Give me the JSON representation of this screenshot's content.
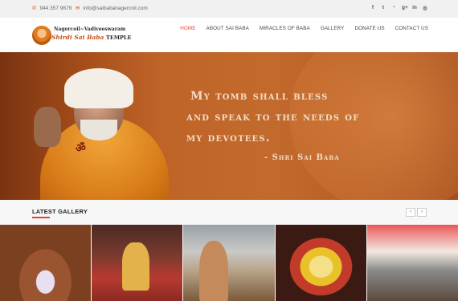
{
  "topbar": {
    "phone_icon": "phone-icon",
    "phone": "944 357 9679",
    "email_icon": "envelope-icon",
    "email": "info@saibabanagercoil.com",
    "social": [
      {
        "icon": "facebook-icon",
        "glyph": "f"
      },
      {
        "icon": "twitter-icon",
        "glyph": "t"
      },
      {
        "icon": "rss-icon",
        "glyph": "◔"
      },
      {
        "icon": "google-plus-icon",
        "glyph": "g+"
      },
      {
        "icon": "linkedin-icon",
        "glyph": "in"
      },
      {
        "icon": "dribbble-icon",
        "glyph": "◎"
      }
    ]
  },
  "logo": {
    "line1": "Nagercoil~Vadiveeswaram",
    "line2": "Shirdi Sai Baba",
    "line2_suffix": "TEMPLE"
  },
  "nav": {
    "items": [
      "HOME",
      "ABOUT SAI BABA",
      "MIRACLES OF BABA",
      "GALLERY",
      "DONATE US",
      "CONTACT US"
    ],
    "active": "HOME"
  },
  "hero": {
    "quote_line1": "My tomb shall bless",
    "quote_line2": "and speak to the needs of",
    "quote_line3": "my devotees.",
    "attribution": "- Shri Sai Baba"
  },
  "gallery": {
    "title": "LATEST GALLERY",
    "prev_label": "‹",
    "next_label": "›"
  },
  "colors": {
    "accent": "#e8402a",
    "hero_text": "#f2ddc7",
    "topbar_bg": "#f1f1f1"
  }
}
